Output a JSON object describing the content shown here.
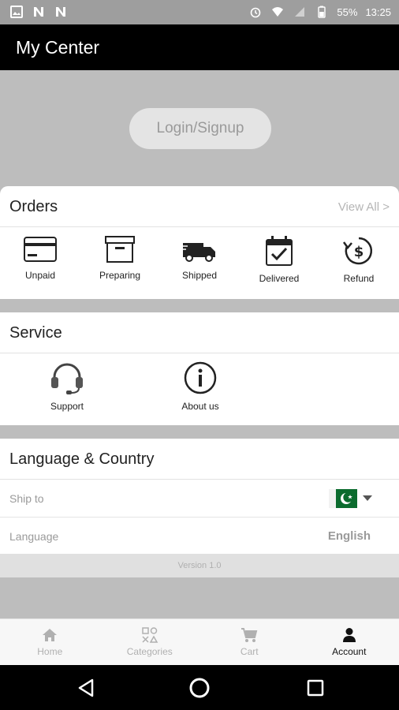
{
  "statusbar": {
    "battery": "55%",
    "time": "13:25"
  },
  "appbar": {
    "title": "My Center"
  },
  "login": {
    "label": "Login/Signup"
  },
  "orders": {
    "title": "Orders",
    "view_all": "View All >",
    "items": [
      {
        "label": "Unpaid",
        "icon": "card-icon"
      },
      {
        "label": "Preparing",
        "icon": "box-icon"
      },
      {
        "label": "Shipped",
        "icon": "truck-icon"
      },
      {
        "label": "Delivered",
        "icon": "calendar-check-icon"
      },
      {
        "label": "Refund",
        "icon": "refund-dollar-icon"
      }
    ]
  },
  "service": {
    "title": "Service",
    "items": [
      {
        "label": "Support",
        "icon": "headset-icon"
      },
      {
        "label": "About us",
        "icon": "info-icon"
      }
    ]
  },
  "language_country": {
    "title": "Language & Country",
    "ship_to_label": "Ship to",
    "language_label": "Language",
    "language_value": "English"
  },
  "version": "Version 1.0",
  "tabbar": {
    "tabs": [
      {
        "label": "Home",
        "icon": "home-icon"
      },
      {
        "label": "Categories",
        "icon": "categories-icon"
      },
      {
        "label": "Cart",
        "icon": "cart-icon"
      },
      {
        "label": "Account",
        "icon": "account-icon",
        "active": true
      }
    ]
  }
}
